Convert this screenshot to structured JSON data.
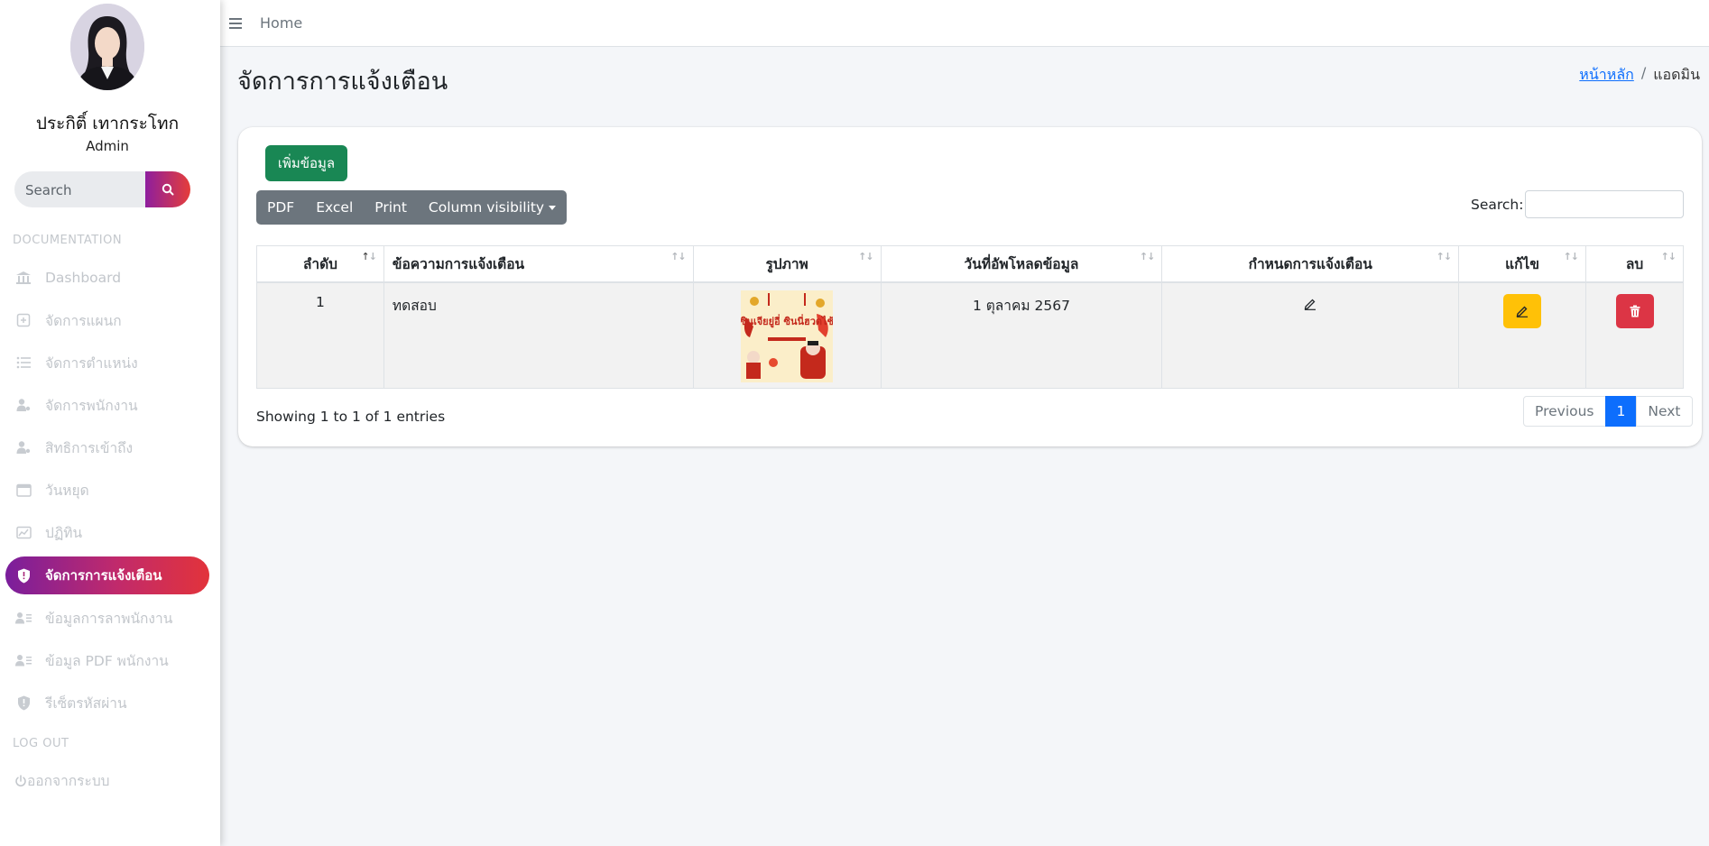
{
  "sidebar": {
    "user_name": "ประกิติ์ เทากระโทก",
    "user_role": "Admin",
    "search_placeholder": "Search",
    "section_documentation": "DOCUMENTATION",
    "section_logout": "LOG OUT",
    "items": [
      {
        "label": "Dashboard",
        "icon": "bank-icon"
      },
      {
        "label": "จัดการแผนก",
        "icon": "add-square-icon"
      },
      {
        "label": "จัดการตำแหน่ง",
        "icon": "list-icon"
      },
      {
        "label": "จัดการพนักงาน",
        "icon": "user-gear-icon"
      },
      {
        "label": "สิทธิการเข้าถึง",
        "icon": "user-gear-icon"
      },
      {
        "label": "วันหยุด",
        "icon": "calendar-icon"
      },
      {
        "label": "ปฏิทิน",
        "icon": "chart-icon"
      },
      {
        "label": "จัดการการแจ้งเตือน",
        "icon": "shield-icon",
        "active": true
      },
      {
        "label": "ข้อมูลการลาพนักงาน",
        "icon": "user-list-icon"
      },
      {
        "label": "ข้อมูล PDF พนักงาน",
        "icon": "user-list-icon"
      },
      {
        "label": "รีเซ็ตรหัสผ่าน",
        "icon": "shield-icon"
      }
    ],
    "logout_label": "ออกจากระบบ"
  },
  "topbar": {
    "home_label": "Home"
  },
  "header": {
    "title": "จัดการการแจ้งเตือน",
    "breadcrumb_home": "หน้าหลัก",
    "breadcrumb_sep": "/",
    "breadcrumb_current": "แอดมิน"
  },
  "toolbar": {
    "add_label": "เพิ่มข้อมูล",
    "pdf_label": "PDF",
    "excel_label": "Excel",
    "print_label": "Print",
    "colvis_label": "Column visibility",
    "search_label": "Search:"
  },
  "table": {
    "headers": [
      "ลำดับ",
      "ข้อความการแจ้งเตือน",
      "รูปภาพ",
      "วันที่อัพโหลดข้อมูล",
      "กำหนดการแจ้งเตือน",
      "แก้ไข",
      "ลบ"
    ],
    "rows": [
      {
        "index": "1",
        "message": "ทดสอบ",
        "image_text": "ซินเจียยู่อี่ ซินนี่ฮวดไช้",
        "date": "1 ตุลาคม 2567"
      }
    ]
  },
  "footer": {
    "info": "Showing 1 to 1 of 1 entries",
    "prev_label": "Previous",
    "page_label": "1",
    "next_label": "Next"
  },
  "colors": {
    "active_gradient_start": "#7a1e9c",
    "active_gradient_end": "#e2333b",
    "add_button": "#198754",
    "edit_button": "#ffc107",
    "delete_button": "#dc3545",
    "pager_active": "#0d6efd"
  }
}
